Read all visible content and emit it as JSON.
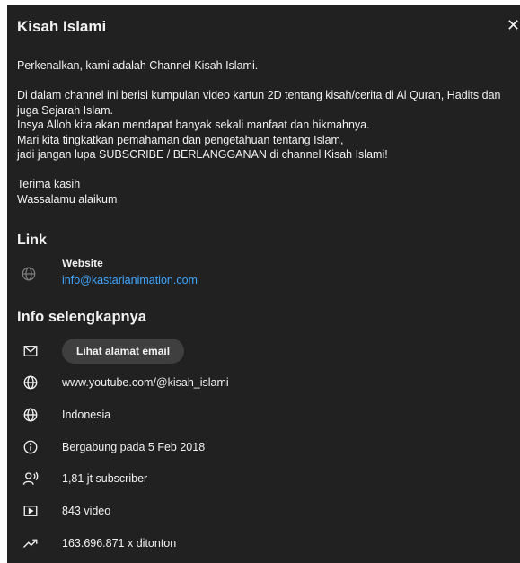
{
  "dialog": {
    "title": "Kisah Islami",
    "close_glyph": "✕"
  },
  "description": [
    "Perkenalkan, kami adalah Channel Kisah Islami.",
    "",
    "Di dalam channel ini berisi kumpulan video kartun 2D tentang kisah/cerita di Al Quran, Hadits dan juga Sejarah Islam.",
    "Insya Alloh kita akan mendapat banyak sekali manfaat dan hikmahnya.",
    "Mari kita tingkatkan pemahaman dan pengetahuan tentang Islam,",
    "jadi jangan lupa SUBSCRIBE / BERLANGGANAN di channel Kisah Islami!",
    "",
    "Terima kasih",
    "Wassalamu alaikum"
  ],
  "links": {
    "heading": "Link",
    "items": [
      {
        "name": "Website",
        "url": "info@kastarianimation.com",
        "icon": "globe-icon"
      }
    ]
  },
  "info": {
    "heading": "Info selengkapnya",
    "email_button": "Lihat alamat email",
    "channel_url": "www.youtube.com/@kisah_islami",
    "country": "Indonesia",
    "joined": "Bergabung pada 5 Feb 2018",
    "subscribers": "1,81 jt subscriber",
    "videos": "843 video",
    "views": "163.696.871 x ditonton"
  },
  "colors": {
    "background": "#212121",
    "text": "#f1f1f1",
    "link": "#3ea6ff",
    "button": "#3f3f3f"
  }
}
